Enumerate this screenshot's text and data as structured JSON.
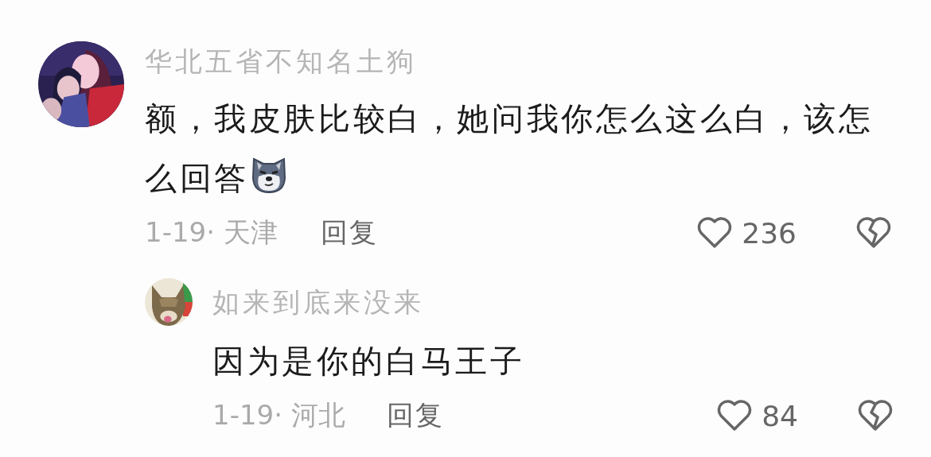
{
  "comments": [
    {
      "author": "华北五省不知名土狗",
      "text": "额，我皮肤比较白，她问我你怎么这么白，该怎么回答",
      "emoji": true,
      "meta": "1-19· 天津",
      "reply_label": "回复",
      "likes": "236",
      "replies": [
        {
          "author": "如来到底来没来",
          "text": "因为是你的白马王子",
          "meta": "1-19· 河北",
          "reply_label": "回复",
          "likes": "84"
        }
      ]
    }
  ]
}
